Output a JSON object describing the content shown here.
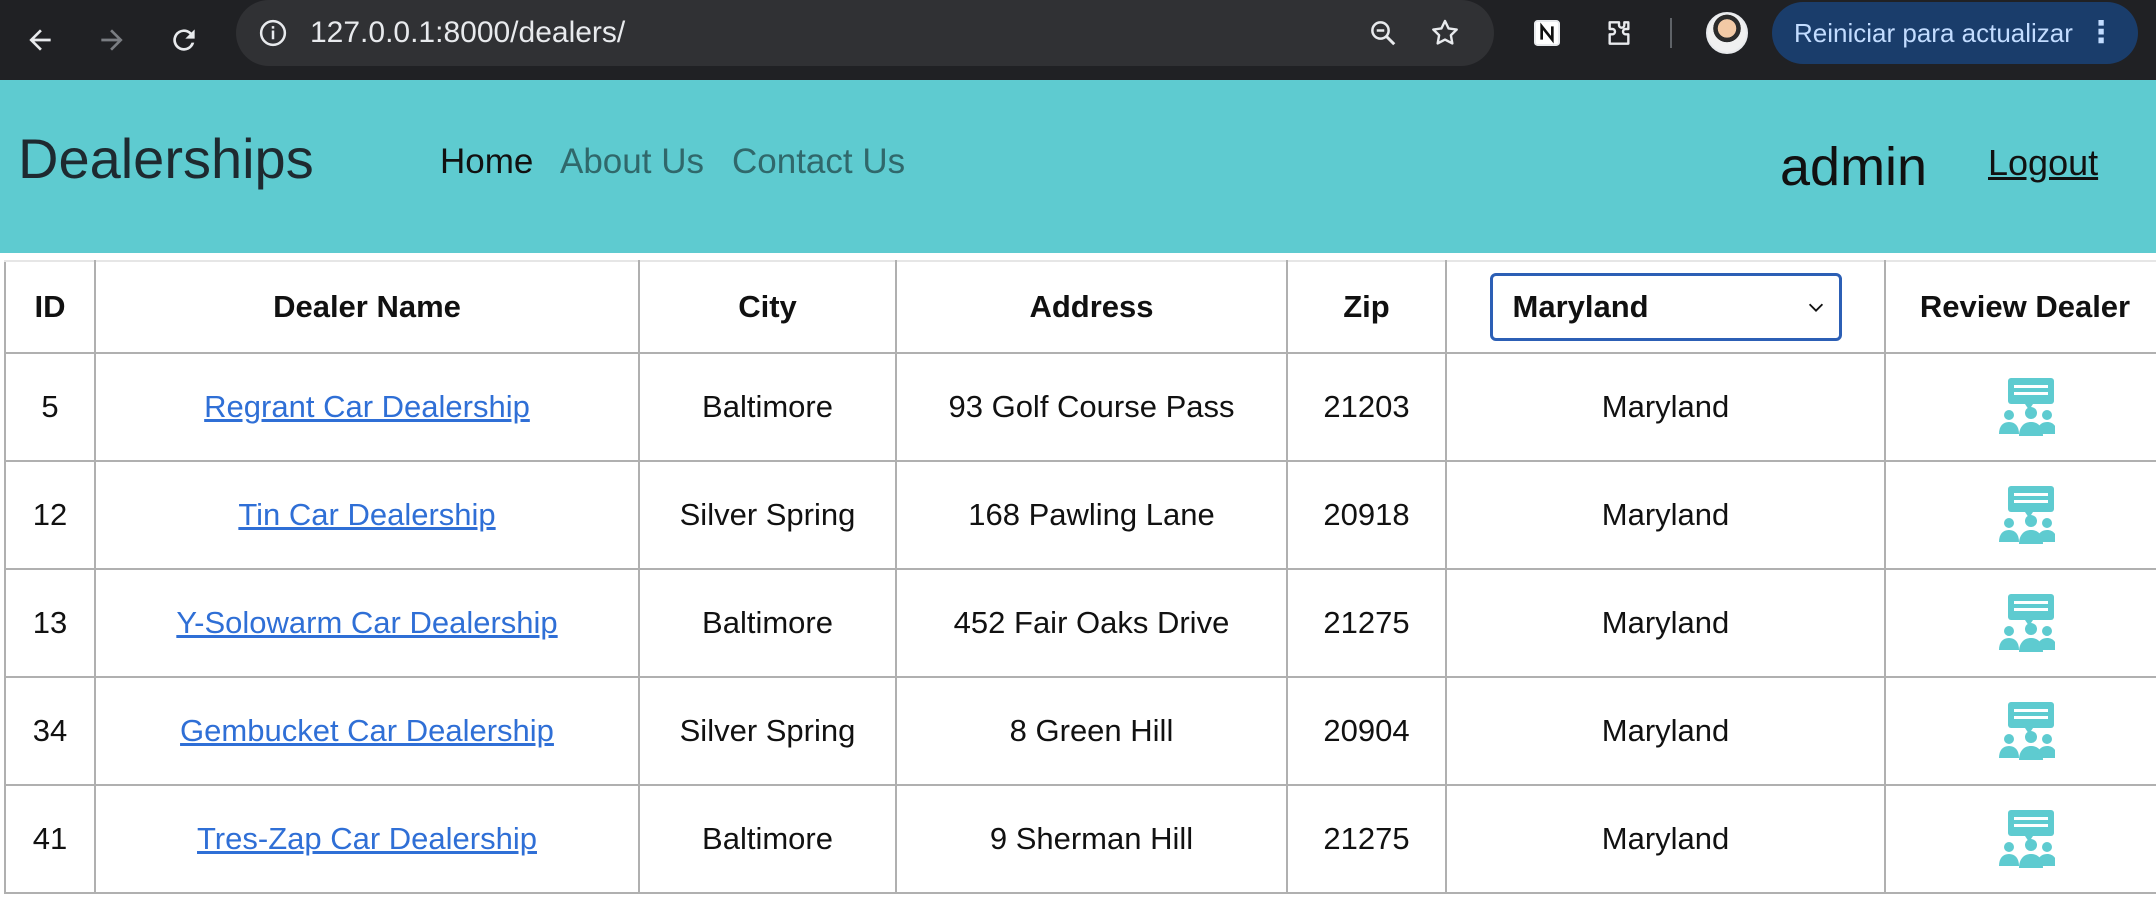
{
  "browser": {
    "url": "127.0.0.1:8000/dealers/",
    "update_button_label": "Reiniciar para actualizar",
    "icons": [
      "back-arrow-icon",
      "forward-arrow-icon",
      "reload-icon",
      "site-info-icon",
      "zoom-icon",
      "bookmark-star-icon",
      "notion-extension-icon",
      "extensions-puzzle-icon",
      "profile-avatar",
      "more-menu-icon"
    ]
  },
  "navbar": {
    "brand": "Dealerships",
    "links": [
      "Home",
      "About Us",
      "Contact Us"
    ],
    "username": "admin",
    "logout_label": "Logout",
    "background_color": "#5ecbd0"
  },
  "table": {
    "headers": {
      "id": "ID",
      "name": "Dealer Name",
      "city": "City",
      "address": "Address",
      "zip": "Zip",
      "review": "Review Dealer"
    },
    "state_filter": {
      "selected": "Maryland"
    },
    "rows": [
      {
        "id": "5",
        "name": "Regrant Car Dealership",
        "city": "Baltimore",
        "address": "93 Golf Course Pass",
        "zip": "21203",
        "state": "Maryland"
      },
      {
        "id": "12",
        "name": "Tin Car Dealership",
        "city": "Silver Spring",
        "address": "168 Pawling Lane",
        "zip": "20918",
        "state": "Maryland"
      },
      {
        "id": "13",
        "name": "Y-Solowarm Car Dealership",
        "city": "Baltimore",
        "address": "452 Fair Oaks Drive",
        "zip": "21275",
        "state": "Maryland"
      },
      {
        "id": "34",
        "name": "Gembucket Car Dealership",
        "city": "Silver Spring",
        "address": "8 Green Hill",
        "zip": "20904",
        "state": "Maryland"
      },
      {
        "id": "41",
        "name": "Tres-Zap Car Dealership",
        "city": "Baltimore",
        "address": "9 Sherman Hill",
        "zip": "21275",
        "state": "Maryland"
      }
    ],
    "review_icon": "review-dealer-icon",
    "link_color": "#2f6fd6",
    "icon_color": "#5ecbd0"
  }
}
